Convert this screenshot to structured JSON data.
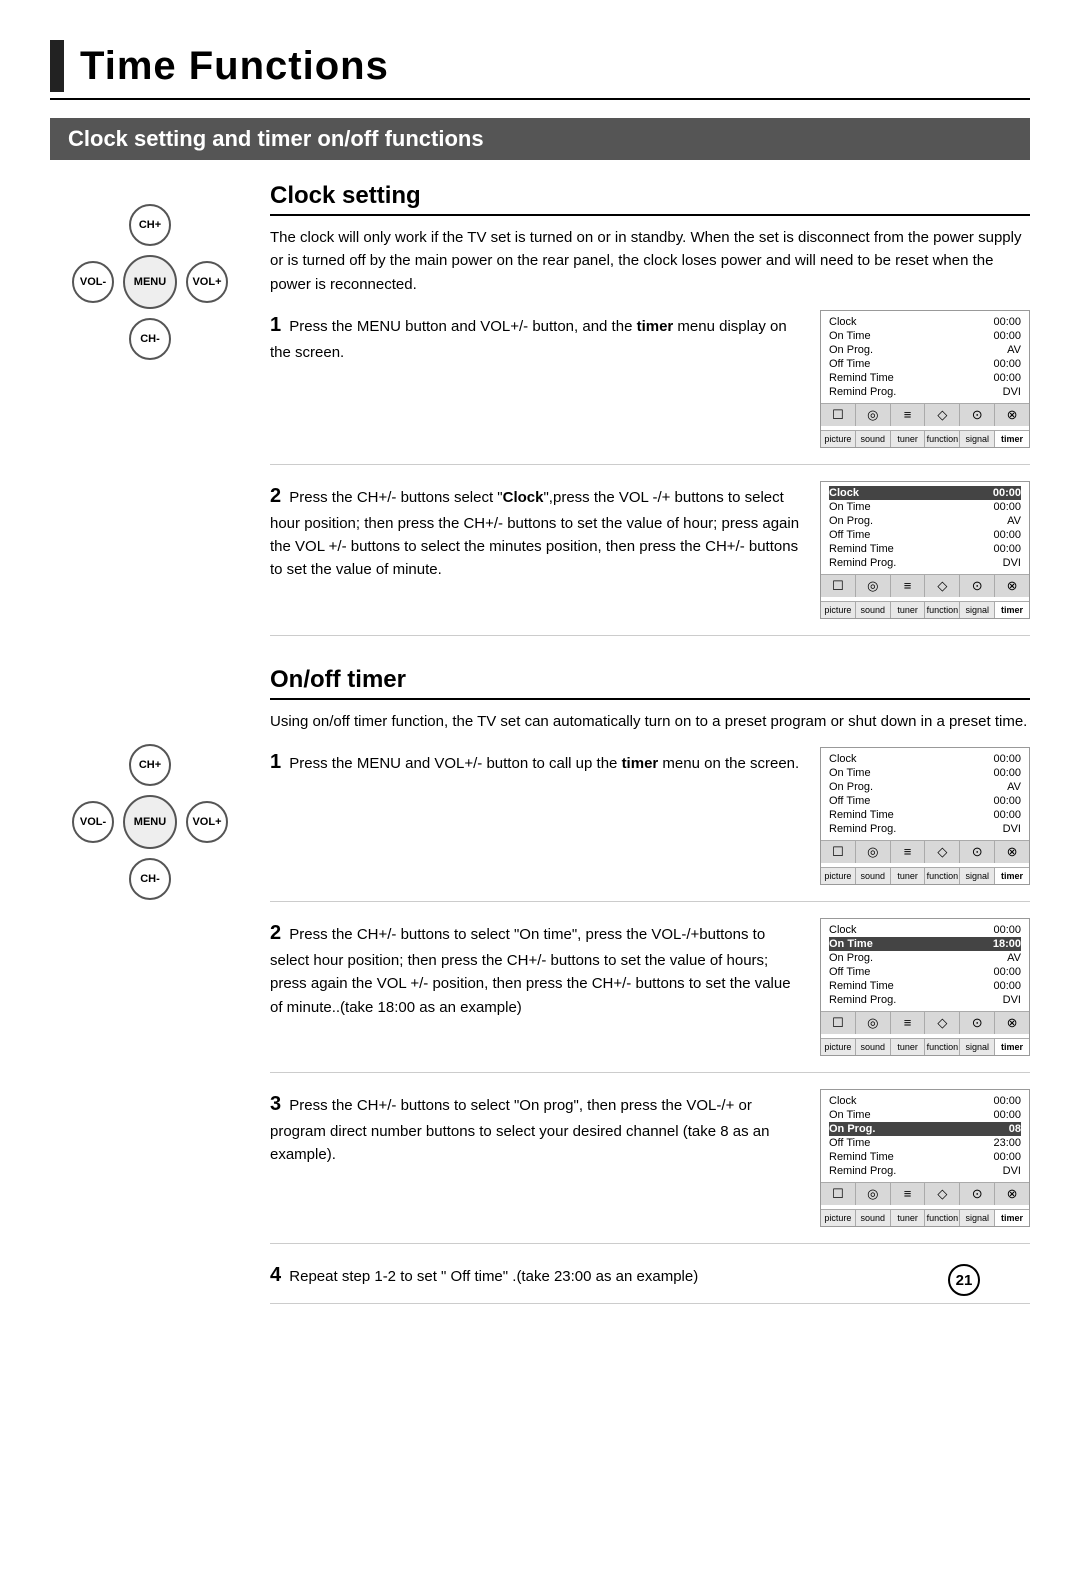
{
  "page": {
    "title": "Time Functions",
    "page_number": "21"
  },
  "section_header": "Clock setting  and timer on/off functions",
  "clock_setting": {
    "title": "Clock setting",
    "intro": "The clock will only work if the TV set is  turned on or in standby. When the set is disconnect from the power supply or is turned off by the main power on the rear panel, the clock loses power and will need to be reset when the power is reconnected.",
    "steps": [
      {
        "number": "1",
        "text": "Press the MENU button and VOL+/- button, and the timer menu display on the screen.",
        "bold_word": "timer"
      },
      {
        "number": "2",
        "text": "Press the CH+/- buttons select \"Clock\",press the VOL -/+ buttons to select hour position; then press the CH+/- buttons to set the value of hour; press again the VOL +/- buttons to select the minutes position, then press the CH+/- buttons to set the value of minute.",
        "bold_word": "Clock"
      }
    ]
  },
  "onoff_timer": {
    "title": "On/off timer",
    "intro": "Using on/off timer function, the TV set can automatically turn on to a preset program or shut down in a preset time.",
    "steps": [
      {
        "number": "1",
        "text": "Press the MENU and VOL+/- button to call up the timer menu on the screen.",
        "bold_word": "timer"
      },
      {
        "number": "2",
        "text": "Press the CH+/- buttons to select \"On time\", press the VOL-/+buttons to select hour position; then press the CH+/- buttons to set the value of hours; press again the VOL +/- position, then press the CH+/- buttons to set the value of minute..(take 18:00 as an example)"
      },
      {
        "number": "3",
        "text": "Press the CH+/- buttons to select \"On prog\", then press the VOL-/+ or program direct number buttons to select your desired channel (take 8 as an example)."
      },
      {
        "number": "4",
        "text": "Repeat step 1-2 to set \" Off time\" .(take 23:00 as an example)"
      }
    ]
  },
  "menus": [
    {
      "id": "menu1",
      "rows": [
        {
          "label": "Clock",
          "value": "00:00"
        },
        {
          "label": "On Time",
          "value": "00:00"
        },
        {
          "label": "On Prog.",
          "value": "AV"
        },
        {
          "label": "Off Time",
          "value": "00:00"
        },
        {
          "label": "Remind Time",
          "value": "00:00"
        },
        {
          "label": "Remind Prog.",
          "value": "DVI"
        }
      ],
      "active_tab": "timer"
    },
    {
      "id": "menu2",
      "rows": [
        {
          "label": "Clock",
          "value": "00:00"
        },
        {
          "label": "On Time",
          "value": "00:00"
        },
        {
          "label": "On Prog.",
          "value": "AV"
        },
        {
          "label": "Off Time",
          "value": "00:00"
        },
        {
          "label": "Remind Time",
          "value": "00:00"
        },
        {
          "label": "Remind Prog.",
          "value": "DVI"
        }
      ],
      "active_tab": "timer"
    },
    {
      "id": "menu3",
      "rows": [
        {
          "label": "Clock",
          "value": "00:00"
        },
        {
          "label": "On Time",
          "value": "00:00"
        },
        {
          "label": "On Prog.",
          "value": "AV"
        },
        {
          "label": "Off Time",
          "value": "00:00"
        },
        {
          "label": "Remind Time",
          "value": "00:00"
        },
        {
          "label": "Remind Prog.",
          "value": "DVI"
        }
      ],
      "active_tab": "timer"
    },
    {
      "id": "menu4",
      "rows": [
        {
          "label": "Clock",
          "value": "00:00"
        },
        {
          "label": "On Time",
          "value": "18:00"
        },
        {
          "label": "On Prog.",
          "value": "AV"
        },
        {
          "label": "Off Time",
          "value": "00:00"
        },
        {
          "label": "Remind Time",
          "value": "00:00"
        },
        {
          "label": "Remind Prog.",
          "value": "DVI"
        }
      ],
      "active_tab": "timer"
    },
    {
      "id": "menu5",
      "rows": [
        {
          "label": "Clock",
          "value": "00:00"
        },
        {
          "label": "On Time",
          "value": "00:00"
        },
        {
          "label": "On Prog.",
          "value": "08"
        },
        {
          "label": "Off Time",
          "value": "23:00"
        },
        {
          "label": "Remind Time",
          "value": "00:00"
        },
        {
          "label": "Remind Prog.",
          "value": "DVI"
        }
      ],
      "active_tab": "timer"
    }
  ],
  "remote": {
    "center": "MENU",
    "top": "CH+",
    "bottom": "CH-",
    "left": "VOL-",
    "right": "VOL+"
  },
  "tabs": [
    "picture",
    "sound",
    "tuner",
    "function",
    "signal",
    "timer"
  ],
  "tab_icons": [
    "☐",
    "◎",
    "≡",
    "◇",
    "⊙",
    "⊗"
  ]
}
